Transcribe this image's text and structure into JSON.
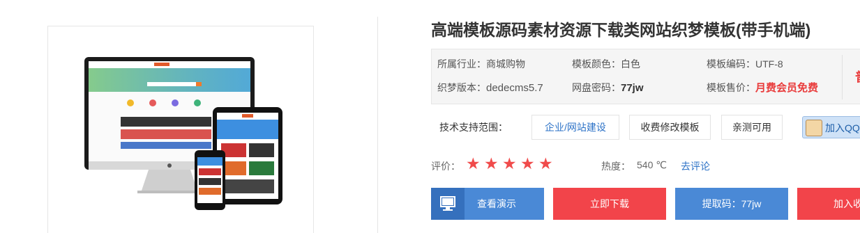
{
  "product": {
    "title": "高端模板源码素材资源下载类网站织梦模板(带手机端)"
  },
  "meta": {
    "industry_label": "所属行业：",
    "industry_value": "商城购物",
    "color_label": "模板颜色：",
    "color_value": "白色",
    "encoding_label": "模板编码：",
    "encoding_value": "UTF-8",
    "version_label": "织梦版本：",
    "version_value": "dedecms5.7",
    "pan_label": "网盘密码：",
    "pan_value": "77jw",
    "price_label": "模板售价：",
    "price_value": "月费会员免费",
    "cut_text": "普"
  },
  "support": {
    "label": "技术支持范围：",
    "tags": [
      "企业/网站建设",
      "收费修改模板",
      "亲测可用"
    ],
    "qq_label": "加入QQ"
  },
  "rating": {
    "label": "评价：",
    "stars": 5,
    "heat_label": "热度：",
    "heat_value": "540 ℃",
    "comment_link": "去评论"
  },
  "actions": {
    "demo": "查看演示",
    "download": "立即下载",
    "code": "提取码：77jw",
    "favorite": "加入收"
  },
  "colors": {
    "accent_blue": "#4a89d6",
    "accent_red": "#f2444a",
    "star": "#f04b4b",
    "price_red": "#e93b3b",
    "link": "#2e73c7"
  }
}
